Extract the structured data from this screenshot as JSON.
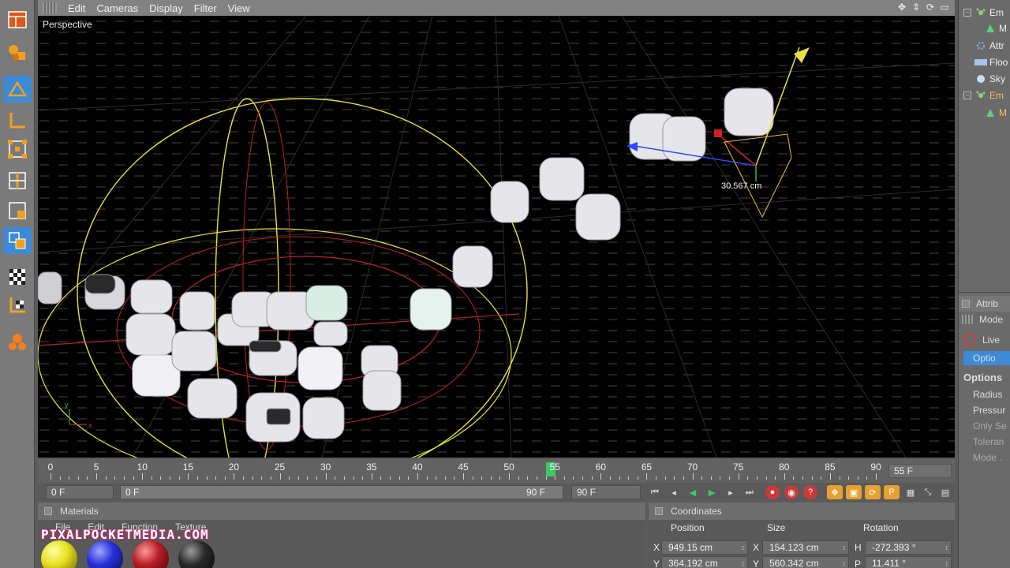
{
  "viewport_menu": {
    "items": [
      "Edit",
      "Cameras",
      "Display",
      "Filter",
      "View"
    ],
    "nav_icons": [
      "move-icon",
      "zoom-icon",
      "rotate-icon",
      "maximize-icon"
    ]
  },
  "viewport": {
    "label": "Perspective",
    "measurement": "30.567 cm"
  },
  "object_manager": {
    "items": [
      {
        "label": "Em",
        "icon": "emitter-icon",
        "highlight": false
      },
      {
        "label": "M",
        "icon": "mesh-icon",
        "highlight": false
      },
      {
        "label": "Attr",
        "icon": "attractor-icon",
        "highlight": false
      },
      {
        "label": "Floo",
        "icon": "floor-icon",
        "highlight": false
      },
      {
        "label": "Sky",
        "icon": "sky-icon",
        "highlight": false
      },
      {
        "label": "Em",
        "icon": "emitter-icon",
        "highlight": true
      },
      {
        "label": "M",
        "icon": "mesh-icon",
        "highlight": true
      }
    ]
  },
  "attributes": {
    "title": "Attrib",
    "mode": "Mode",
    "live": "Live",
    "tab": "Optio",
    "section": "Options",
    "fields": [
      "Radius",
      "Pressur",
      "Only Se",
      "Toleran",
      "Mode ."
    ]
  },
  "timeline": {
    "ticks": [
      0,
      5,
      10,
      15,
      20,
      25,
      30,
      35,
      40,
      45,
      50,
      55,
      60,
      65,
      70,
      75,
      80,
      85,
      90
    ],
    "max": 90,
    "current": 55,
    "current_label": "55 F"
  },
  "transport": {
    "start": "0 F",
    "range_start": "0 F",
    "range_end": "90 F",
    "end": "90 F"
  },
  "materials": {
    "title": "Materials",
    "menus": [
      "File",
      "Edit",
      "Function",
      "Texture"
    ],
    "swatches": [
      "#e8e020",
      "#2630d8",
      "#b81c24",
      "#2a2a2a"
    ]
  },
  "watermark": "PIXALPOCKETMEDIA.COM",
  "coordinates": {
    "title": "Coordinates",
    "headers": {
      "position": "Position",
      "size": "Size",
      "rotation": "Rotation"
    },
    "rows": [
      {
        "axis": "X",
        "position": "949.15 cm",
        "size_axis": "X",
        "size": "154.123 cm",
        "rot_axis": "H",
        "rotation": "-272.393 °"
      },
      {
        "axis": "Y",
        "position": "364.192 cm",
        "size_axis": "Y",
        "size": "560.342 cm",
        "rot_axis": "P",
        "rotation": "11.411 °"
      }
    ]
  }
}
